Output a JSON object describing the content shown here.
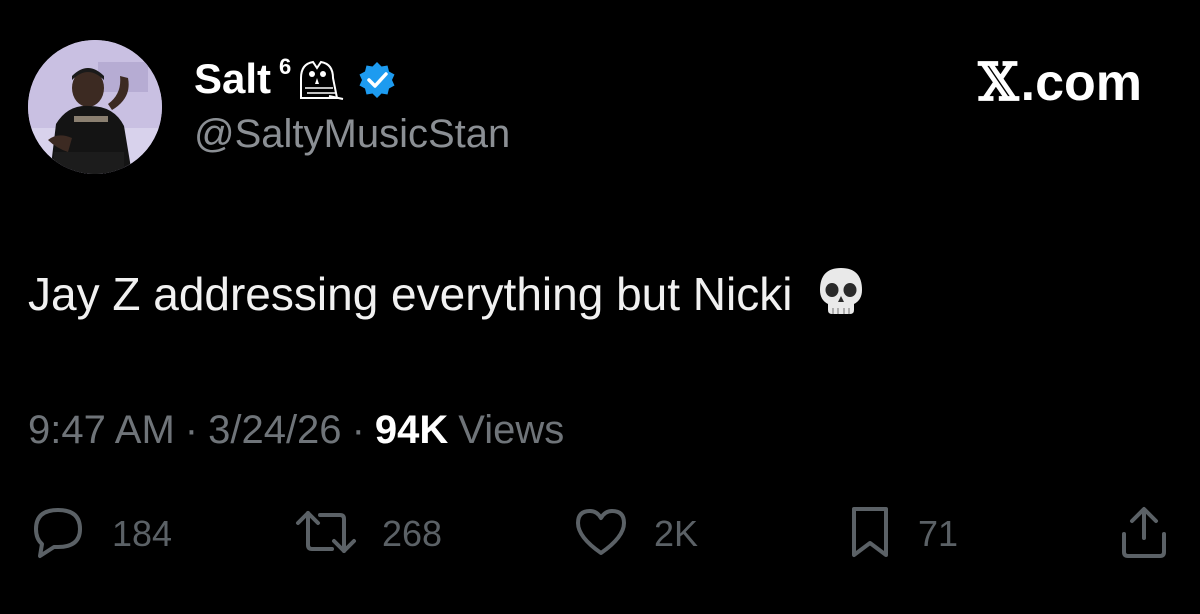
{
  "author": {
    "name": "Salt",
    "name_superscript": "6",
    "handle": "@SaltyMusicStan",
    "verified_badge_color": "#1d9bf0"
  },
  "brand": {
    "x_glyph": "𝕏",
    "domain": ".com"
  },
  "tweet": {
    "text": "Jay Z addressing everything but Nicki",
    "emoji_icon": "skull-icon"
  },
  "meta": {
    "time": "9:47 AM",
    "date": "3/24/26",
    "separator": "·",
    "views_count": "94K",
    "views_label": "Views"
  },
  "actions": {
    "replies": "184",
    "reposts": "268",
    "likes": "2K",
    "bookmarks": "71"
  }
}
